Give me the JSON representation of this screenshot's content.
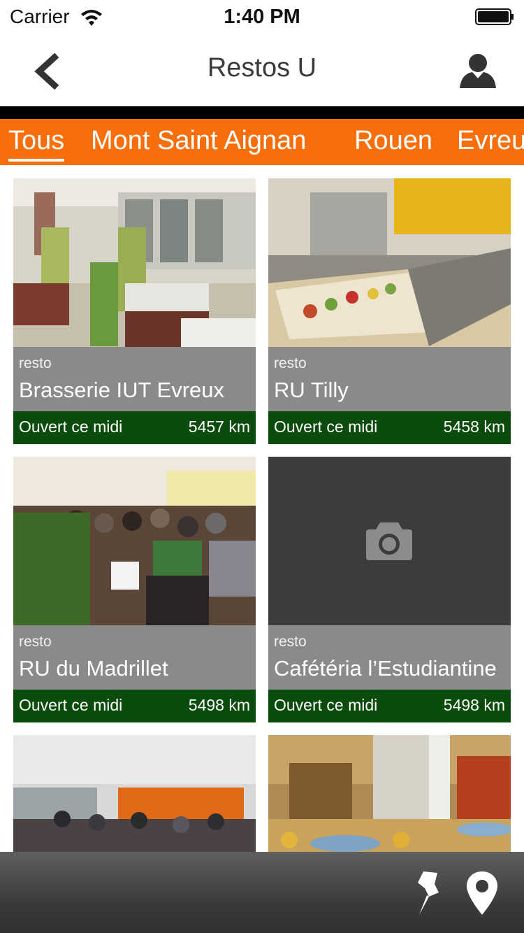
{
  "status_bar": {
    "carrier": "Carrier",
    "time": "1:40 PM",
    "wifi_icon": "wifi-icon",
    "battery_icon": "battery-icon"
  },
  "nav": {
    "title": "Restos U",
    "back_icon": "chevron-left-icon",
    "profile_icon": "person-icon"
  },
  "tabs": [
    {
      "label": "Tous",
      "active": true
    },
    {
      "label": "Mont Saint Aignan",
      "active": false
    },
    {
      "label": "Rouen",
      "active": false
    },
    {
      "label": "Evreux",
      "active": false
    }
  ],
  "restaurants": [
    {
      "type": "resto",
      "name": "Brasserie IUT Evreux",
      "status": "Ouvert ce midi",
      "distance": "5457 km",
      "photo": "cafeteria-dining-room"
    },
    {
      "type": "resto",
      "name": "RU Tilly",
      "status": "Ouvert ce midi",
      "distance": "5458 km",
      "photo": "food-counter"
    },
    {
      "type": "resto",
      "name": "RU du Madrillet",
      "status": "Ouvert ce midi",
      "distance": "5498 km",
      "photo": "crowded-dining-hall"
    },
    {
      "type": "resto",
      "name": "Cafétéria l’Estudiantine",
      "status": "Ouvert ce midi",
      "distance": "5498 km",
      "photo": "camera-placeholder"
    },
    {
      "type": "resto",
      "name": "",
      "status": "",
      "distance": "",
      "photo": "dining-hall-orange-wall"
    },
    {
      "type": "resto",
      "name": "",
      "status": "",
      "distance": "",
      "photo": "cafeteria-yellow-chairs"
    }
  ],
  "toolbar": {
    "pin_icon": "pushpin-icon",
    "location_icon": "map-marker-icon"
  },
  "colors": {
    "accent_orange": "#f76e0d",
    "status_green": "#0b4b0b",
    "info_gray": "#8a8a8a",
    "placeholder_dark": "#3c3c3c"
  }
}
